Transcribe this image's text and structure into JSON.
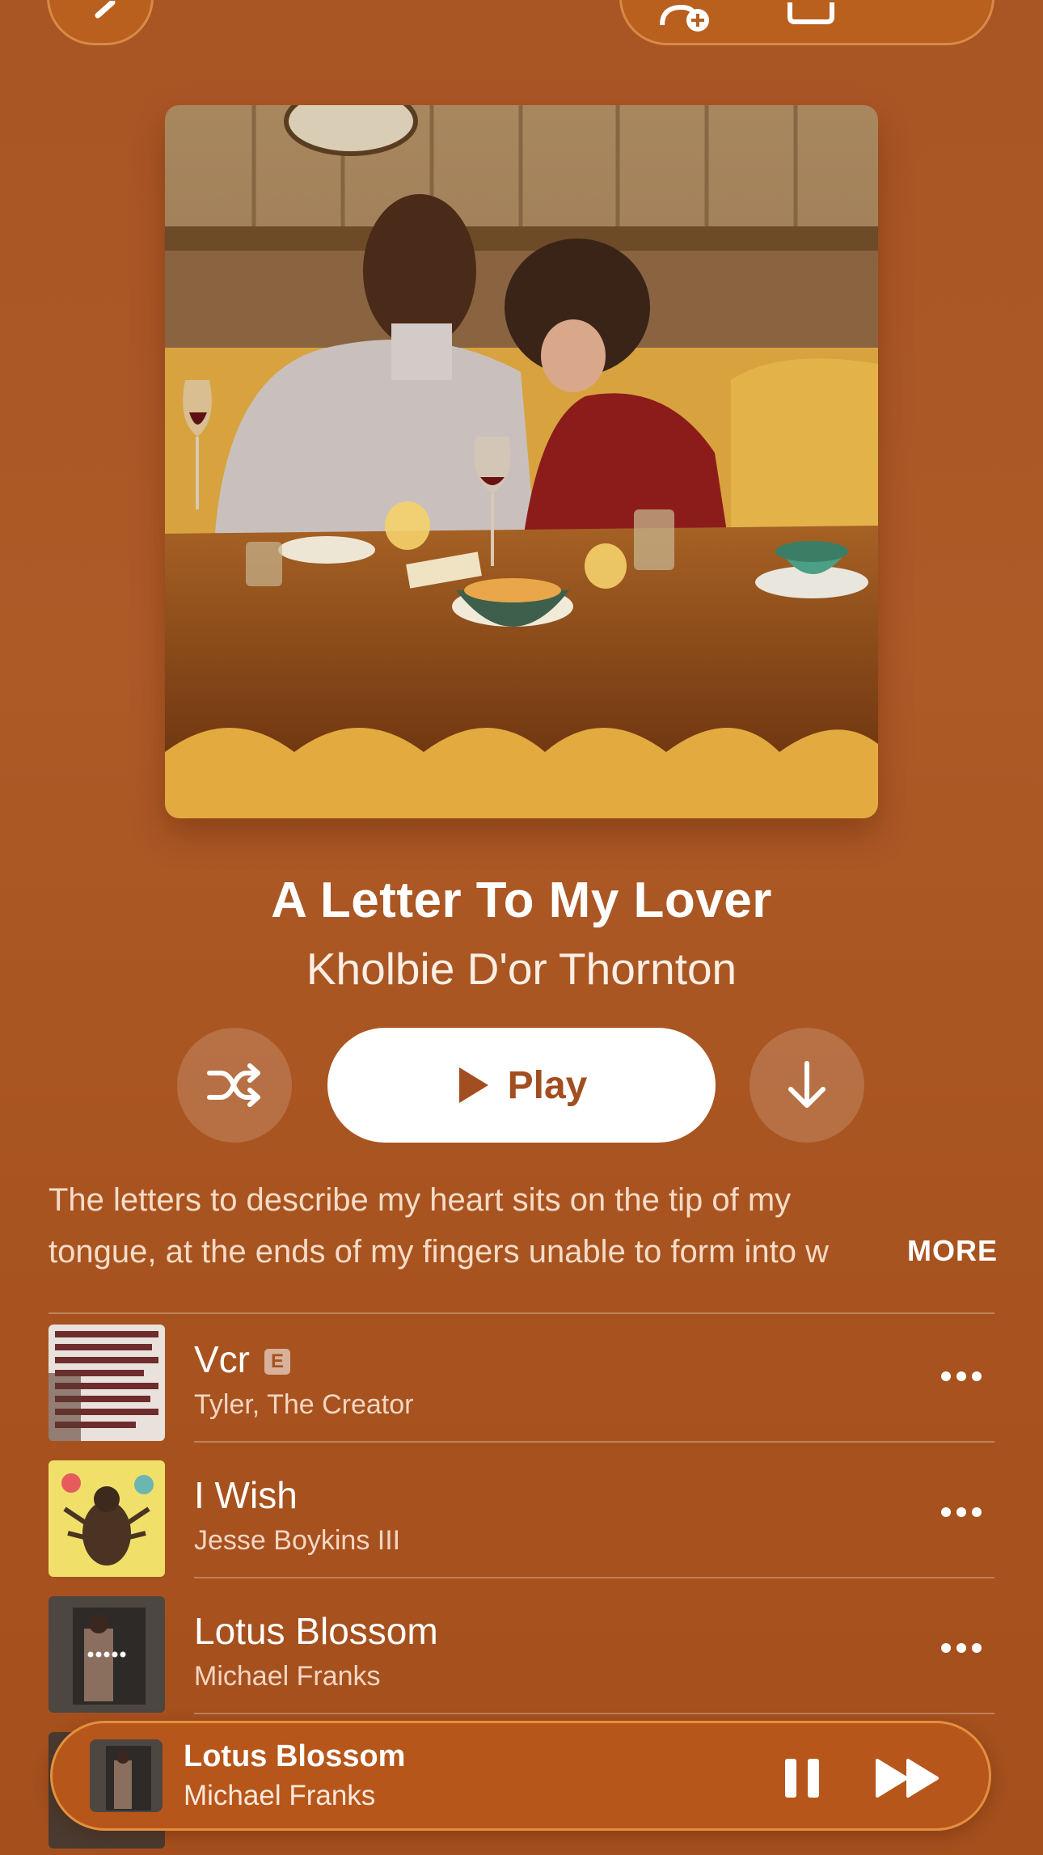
{
  "album": {
    "title": "A Letter To My Lover",
    "artist": "Kholbie D'or Thornton",
    "play_label": "Play",
    "description_line1": "The letters to describe my heart sits on the tip of my",
    "description_line2": "tongue, at the ends of my fingers unable to form into w",
    "more_label": "MORE"
  },
  "tracks": [
    {
      "name": "Vcr",
      "artist": "Tyler, The Creator",
      "explicit": "E"
    },
    {
      "name": "I Wish",
      "artist": "Jesse Boykins III"
    },
    {
      "name": "Lotus Blossom",
      "artist": "Michael Franks"
    }
  ],
  "now_playing": {
    "title": "Lotus Blossom",
    "artist": "Michael Franks"
  },
  "icons": {
    "back": "chevron-left-icon",
    "add_person": "person-add-icon",
    "share": "share-icon",
    "shuffle": "shuffle-icon",
    "download": "download-icon",
    "more": "ellipsis-icon",
    "pause": "pause-icon",
    "forward": "fast-forward-icon"
  },
  "colors": {
    "background": "#a95524",
    "accent": "#a24e20"
  }
}
